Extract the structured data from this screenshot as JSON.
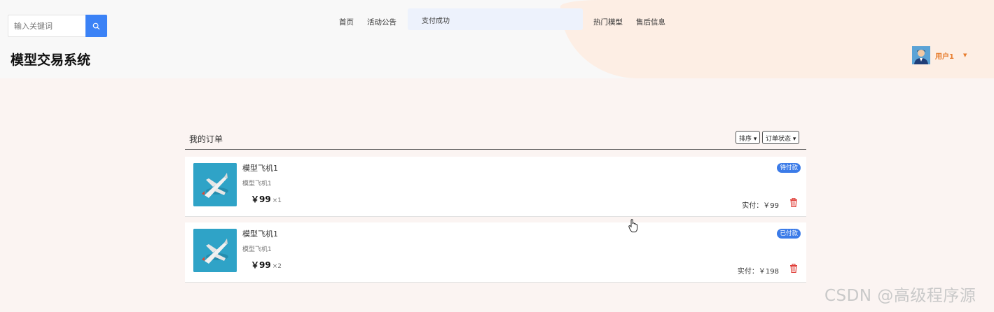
{
  "search": {
    "placeholder": "输入关键词"
  },
  "nav": [
    "首页",
    "活动公告",
    "热门模型",
    "售后信息"
  ],
  "toast": {
    "message": "支付成功"
  },
  "site": {
    "title": "模型交易系统"
  },
  "user": {
    "name": "用户1"
  },
  "orders": {
    "title": "我的订单",
    "sort_label": "排序",
    "status_label": "订单状态",
    "items": [
      {
        "name": "模型飞机1",
        "subtitle": "模型飞机1",
        "price": "￥99",
        "qty": "×1",
        "status": "待付款",
        "paid_label": "实付：",
        "paid_amount": "￥99"
      },
      {
        "name": "模型飞机1",
        "subtitle": "模型飞机1",
        "price": "￥99",
        "qty": "×2",
        "status": "已付款",
        "paid_label": "实付：",
        "paid_amount": "￥198"
      }
    ]
  },
  "watermark": "CSDN @高级程序源",
  "colors": {
    "accent": "#3b82f6",
    "badge": "#3b7be8",
    "user": "#e77b2b",
    "danger": "#e0403a"
  }
}
